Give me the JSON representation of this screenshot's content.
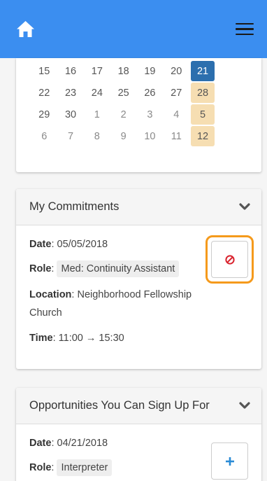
{
  "header": {
    "home_icon": "home-icon",
    "menu_icon": "hamburger-menu-icon",
    "bar_color": "#3b8ef0"
  },
  "calendar": {
    "weeks": [
      [
        {
          "day": "15"
        },
        {
          "day": "16"
        },
        {
          "day": "17"
        },
        {
          "day": "18"
        },
        {
          "day": "19"
        },
        {
          "day": "20"
        },
        {
          "day": "21",
          "state": "today"
        }
      ],
      [
        {
          "day": "22"
        },
        {
          "day": "23"
        },
        {
          "day": "24"
        },
        {
          "day": "25"
        },
        {
          "day": "26"
        },
        {
          "day": "27"
        },
        {
          "day": "28",
          "state": "highlight"
        }
      ],
      [
        {
          "day": "29"
        },
        {
          "day": "30"
        },
        {
          "day": "1",
          "state": "other"
        },
        {
          "day": "2",
          "state": "other"
        },
        {
          "day": "3",
          "state": "other"
        },
        {
          "day": "4",
          "state": "other"
        },
        {
          "day": "5",
          "state": "highlight"
        }
      ],
      [
        {
          "day": "6",
          "state": "other"
        },
        {
          "day": "7",
          "state": "other"
        },
        {
          "day": "8",
          "state": "other"
        },
        {
          "day": "9",
          "state": "other"
        },
        {
          "day": "10",
          "state": "other"
        },
        {
          "day": "11",
          "state": "other"
        },
        {
          "day": "12",
          "state": "highlight"
        }
      ]
    ],
    "today_color": "#2c6fae",
    "highlight_color": "#f6deb2"
  },
  "commitments": {
    "title": "My Commitments",
    "date_label": "Date",
    "date_value": "05/05/2018",
    "role_label": "Role",
    "role_value": "Med: Continuity Assistant",
    "location_label": "Location",
    "location_value": "Neighborhood Fellowship Church",
    "time_label": "Time",
    "time_value": "11:00 → 15:30",
    "cancel_icon": "cancel-circle-slash-icon",
    "cancel_color": "#d9232e",
    "focus_color": "#f59a1c"
  },
  "opportunities": {
    "title": "Opportunities You Can Sign Up For",
    "date_label": "Date",
    "date_value": "04/21/2018",
    "role_label": "Role",
    "role_value": "Interpreter",
    "add_icon": "plus-icon",
    "add_color": "#2a8bd6"
  }
}
